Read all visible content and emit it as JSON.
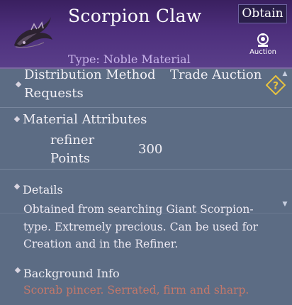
{
  "item": {
    "name": "Scorpion Claw",
    "type_line": "Type: Noble Material"
  },
  "header": {
    "obtain_label": "Obtain",
    "auction_label": "Auction"
  },
  "distribution": {
    "label_line1": "Distribution Method",
    "label_line2": "Requests",
    "value": "Trade Auction"
  },
  "attributes": {
    "title": "Material Attributes",
    "stat_label_line1": "refiner",
    "stat_label_line2": "Points",
    "stat_value": "300"
  },
  "details": {
    "title": "Details",
    "text": "Obtained from searching Giant Scorpion-type. Extremely precious. Can be used for Creation and in the Refiner."
  },
  "background": {
    "title": "Background Info",
    "text": "Scorab pincer. Serrated, firm and sharp."
  },
  "colors": {
    "header_purple": "#4d2f7c",
    "panel_bg": "#5c6c84",
    "accent_gold": "#e8c340",
    "flavor_text": "#c4786a"
  },
  "icons": {
    "help": "question-icon",
    "auction": "auction-icon",
    "scroll_up": "chevron-up-icon",
    "scroll_down": "chevron-down-icon"
  }
}
